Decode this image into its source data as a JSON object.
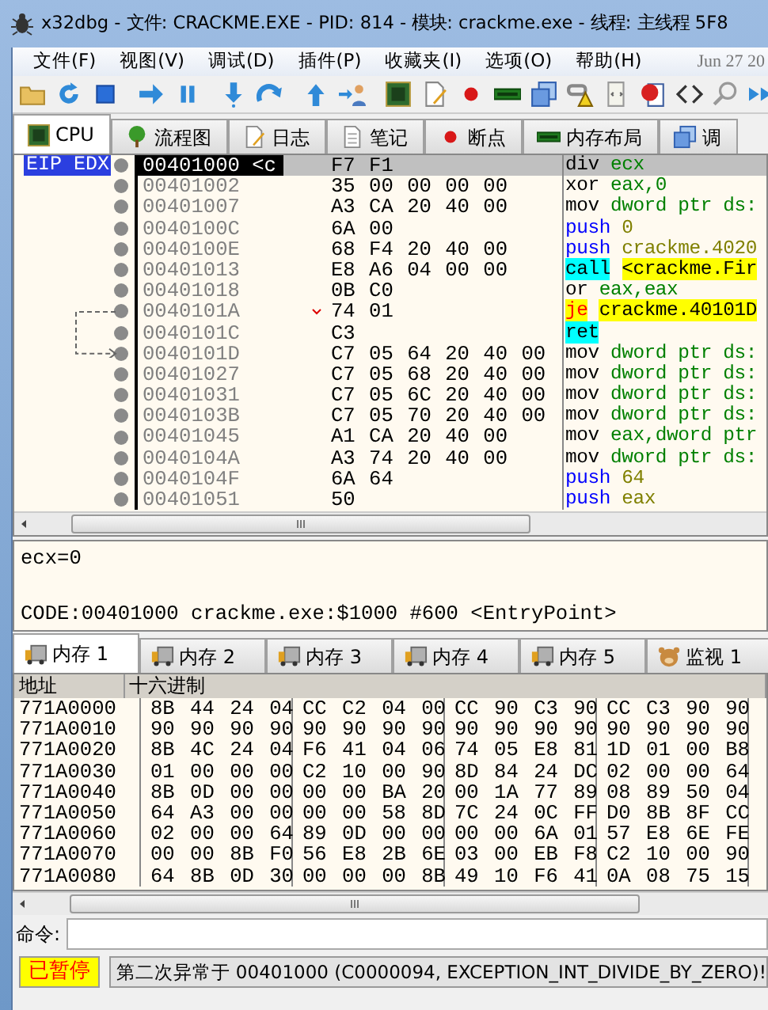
{
  "window": {
    "title": "x32dbg - 文件: CRACKME.EXE - PID: 814 - 模块: crackme.exe - 线程: 主线程 5F8"
  },
  "menu": [
    "文件(F)",
    "视图(V)",
    "调试(D)",
    "插件(P)",
    "收藏夹(I)",
    "选项(O)",
    "帮助(H)"
  ],
  "date": "Jun 27 20",
  "tabs": [
    {
      "label": "CPU",
      "selected": true
    },
    {
      "label": "流程图",
      "selected": false
    },
    {
      "label": "日志",
      "selected": false
    },
    {
      "label": "笔记",
      "selected": false
    },
    {
      "label": "断点",
      "selected": false
    },
    {
      "label": "内存布局",
      "selected": false
    },
    {
      "label": "调",
      "selected": false
    }
  ],
  "disassembly": {
    "register_label": "EIP EDX",
    "rows": [
      {
        "address": "00401000 <c",
        "bytes": "F7 F1",
        "mnemonic": "div",
        "operands": "ecx",
        "kind": "plain",
        "selected": true
      },
      {
        "address": "00401002",
        "bytes": "35 00 00 00 00",
        "mnemonic": "xor",
        "operands": "eax,0",
        "kind": "plain",
        "selected": false
      },
      {
        "address": "00401007",
        "bytes": "A3 CA 20 40 00",
        "mnemonic": "mov",
        "operands": "dword ptr ds:",
        "kind": "plain",
        "selected": false
      },
      {
        "address": "0040100C",
        "bytes": "6A 00",
        "mnemonic": "push",
        "operands": "0",
        "kind": "push",
        "selected": false
      },
      {
        "address": "0040100E",
        "bytes": "68 F4 20 40 00",
        "mnemonic": "push",
        "operands": "crackme.4020",
        "kind": "push",
        "selected": false
      },
      {
        "address": "00401013",
        "bytes": "E8 A6 04 00 00",
        "mnemonic": "call",
        "operands": "<crackme.Fir",
        "kind": "call",
        "selected": false
      },
      {
        "address": "00401018",
        "bytes": "0B C0",
        "mnemonic": "or",
        "operands": "eax,eax",
        "kind": "plain",
        "selected": false
      },
      {
        "address": "0040101A",
        "bytes": "74 01",
        "mnemonic": "je",
        "operands": "crackme.40101D",
        "kind": "jump",
        "selected": false,
        "jump_source": true
      },
      {
        "address": "0040101C",
        "bytes": "C3",
        "mnemonic": "ret",
        "kind": "ret",
        "selected": false
      },
      {
        "address": "0040101D",
        "bytes": "C7 05 64 20 40 00",
        "mnemonic": "mov",
        "operands": "dword ptr ds:",
        "kind": "plain",
        "selected": false,
        "jump_target": true
      },
      {
        "address": "00401027",
        "bytes": "C7 05 68 20 40 00",
        "mnemonic": "mov",
        "operands": "dword ptr ds:",
        "kind": "plain",
        "selected": false
      },
      {
        "address": "00401031",
        "bytes": "C7 05 6C 20 40 00",
        "mnemonic": "mov",
        "operands": "dword ptr ds:",
        "kind": "plain",
        "selected": false
      },
      {
        "address": "0040103B",
        "bytes": "C7 05 70 20 40 00",
        "mnemonic": "mov",
        "operands": "dword ptr ds:",
        "kind": "plain",
        "selected": false
      },
      {
        "address": "00401045",
        "bytes": "A1 CA 20 40 00",
        "mnemonic": "mov",
        "operands": "eax,dword ptr",
        "kind": "plain",
        "selected": false
      },
      {
        "address": "0040104A",
        "bytes": "A3 74 20 40 00",
        "mnemonic": "mov",
        "operands": "dword ptr ds:",
        "kind": "plain",
        "selected": false
      },
      {
        "address": "0040104F",
        "bytes": "6A 64",
        "mnemonic": "push",
        "operands": "64",
        "kind": "push",
        "selected": false
      },
      {
        "address": "00401051",
        "bytes": "50",
        "mnemonic": "push",
        "operands": "eax",
        "kind": "push",
        "selected": false
      }
    ]
  },
  "info": [
    "ecx=0",
    "CODE:00401000 crackme.exe:$1000 #600 <EntryPoint>"
  ],
  "memory_tabs": [
    {
      "label": "内存 1",
      "selected": true
    },
    {
      "label": "内存 2",
      "selected": false
    },
    {
      "label": "内存 3",
      "selected": false
    },
    {
      "label": "内存 4",
      "selected": false
    },
    {
      "label": "内存 5",
      "selected": false
    },
    {
      "label": "监视 1",
      "selected": false
    }
  ],
  "dump": {
    "columns": [
      "地址",
      "十六进制"
    ],
    "rows": [
      {
        "address": "771A0000",
        "groups": [
          "8B 44 24 04",
          "CC C2 04 00",
          "CC 90 C3 90",
          "CC C3 90 90"
        ]
      },
      {
        "address": "771A0010",
        "groups": [
          "90 90 90 90",
          "90 90 90 90",
          "90 90 90 90",
          "90 90 90 90"
        ]
      },
      {
        "address": "771A0020",
        "groups": [
          "8B 4C 24 04",
          "F6 41 04 06",
          "74 05 E8 81",
          "1D 01 00 B8"
        ]
      },
      {
        "address": "771A0030",
        "groups": [
          "01 00 00 00",
          "C2 10 00 90",
          "8D 84 24 DC",
          "02 00 00 64"
        ]
      },
      {
        "address": "771A0040",
        "groups": [
          "8B 0D 00 00",
          "00 00 BA 20",
          "00 1A 77 89",
          "08 89 50 04"
        ]
      },
      {
        "address": "771A0050",
        "groups": [
          "64 A3 00 00",
          "00 00 58 8D",
          "7C 24 0C FF",
          "D0 8B 8F CC"
        ]
      },
      {
        "address": "771A0060",
        "groups": [
          "02 00 00 64",
          "89 0D 00 00",
          "00 00 6A 01",
          "57 E8 6E FE"
        ]
      },
      {
        "address": "771A0070",
        "groups": [
          "00 00 8B F0",
          "56 E8 2B 6E",
          "03 00 EB F8",
          "C2 10 00 90"
        ]
      },
      {
        "address": "771A0080",
        "groups": [
          "64 8B 0D 30",
          "00 00 00 8B",
          "49 10 F6 41",
          "0A 08 75 15"
        ]
      }
    ]
  },
  "command": {
    "label": "命令:"
  },
  "status_bar": {
    "state": "已暂停",
    "message": "第二次异常于 00401000 (C0000094, EXCEPTION_INT_DIVIDE_BY_ZERO)!"
  }
}
